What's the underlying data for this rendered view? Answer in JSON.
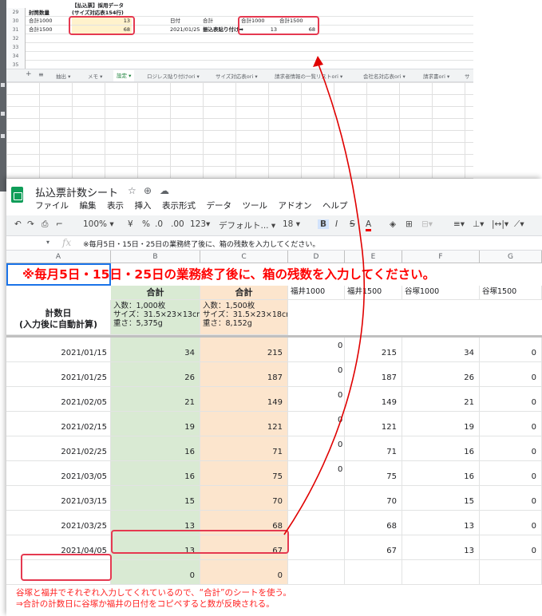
{
  "back_sheet": {
    "row_numbers": [
      "29",
      "30",
      "31",
      "32",
      "33",
      "34",
      "35"
    ],
    "header_row": {
      "label": "封筒数量",
      "data_title_line1": "【払込票】採用データ",
      "data_title_line2": "(サイズ対応表154行)"
    },
    "row30": {
      "label": "合計1000",
      "value": "13",
      "date_label": "日付",
      "total_label": "合計",
      "col1": "合計1000",
      "col2": "合計1500"
    },
    "row31": {
      "label": "合計1500",
      "value": "68",
      "date": "2021/01/25",
      "paste_label": "振込表貼り付け➡",
      "col1": "13",
      "col2": "68"
    },
    "tabs": [
      "抽出",
      "メモ",
      "設定",
      "ロジレス貼り付けori",
      "サイズ対応表ori",
      "請求者情報の一覧リストori",
      "会社名対応表ori",
      "請求書ori",
      "サ"
    ],
    "active_tab": "設定"
  },
  "front_sheet": {
    "title": "払込票計数シート",
    "menu": [
      "ファイル",
      "編集",
      "表示",
      "挿入",
      "表示形式",
      "データ",
      "ツール",
      "アドオン",
      "ヘルプ"
    ],
    "toolbar": {
      "zoom": "100%",
      "currency": "¥",
      "percent": "%",
      "dec_less": ".0",
      "dec_more": ".00",
      "format": "123",
      "font": "デフォルト...",
      "font_size": "18",
      "bold": "B",
      "italic": "I",
      "strike": "S",
      "text_color": "A"
    },
    "formula": "※毎月5日・15日・25日の業務終了後に、箱の残数を入力してください。",
    "columns": [
      "A",
      "B",
      "C",
      "D",
      "E",
      "F",
      "G"
    ],
    "banner": "※毎月5日・15日・25日の業務終了後に、箱の残数を入力してください。",
    "header": {
      "total_b": "合計",
      "total_c": "合計",
      "calc_day_line1": "計数日",
      "calc_day_line2": "(入力後に自動計算)",
      "spec_b": [
        "入数：1,000枚",
        "サイズ：31.5×23×13cm",
        "重さ：5,375g"
      ],
      "spec_c": [
        "入数：1,500枚",
        "サイズ：31.5×23×18cm",
        "重さ：8,152g"
      ],
      "d": "福井1000",
      "e": "福井1500",
      "f": "谷塚1000",
      "g": "谷塚1500"
    },
    "rows": [
      {
        "date": "2021/01/15",
        "b": "34",
        "c": "215",
        "d": "0",
        "e": "215",
        "f": "34",
        "g": "0"
      },
      {
        "date": "2021/01/25",
        "b": "26",
        "c": "187",
        "d": "0",
        "e": "187",
        "f": "26",
        "g": "0"
      },
      {
        "date": "2021/02/05",
        "b": "21",
        "c": "149",
        "d": "0",
        "e": "149",
        "f": "21",
        "g": "0"
      },
      {
        "date": "2021/02/15",
        "b": "19",
        "c": "121",
        "d": "0",
        "e": "121",
        "f": "19",
        "g": "0"
      },
      {
        "date": "2021/02/25",
        "b": "16",
        "c": "71",
        "d": "0",
        "e": "71",
        "f": "16",
        "g": "0"
      },
      {
        "date": "2021/03/05",
        "b": "16",
        "c": "75",
        "d": "0",
        "e": "75",
        "f": "16",
        "g": "0"
      },
      {
        "date": "2021/03/15",
        "b": "15",
        "c": "70",
        "d": "",
        "e": "70",
        "f": "15",
        "g": "0"
      },
      {
        "date": "2021/03/25",
        "b": "13",
        "c": "68",
        "d": "",
        "e": "68",
        "f": "13",
        "g": "0"
      },
      {
        "date": "2021/04/05",
        "b": "13",
        "c": "67",
        "d": "",
        "e": "67",
        "f": "13",
        "g": "0"
      },
      {
        "date": "",
        "b": "0",
        "c": "0",
        "d": "",
        "e": "",
        "f": "",
        "g": ""
      }
    ]
  },
  "annotation": {
    "line1": "谷塚と福井でそれぞれ入力してくれているので、“合計”のシートを使う。",
    "line2": "⇒合計の計数日に谷塚か福井の日付をコピペすると数が反映される。",
    "color": "#ff1f1f"
  }
}
